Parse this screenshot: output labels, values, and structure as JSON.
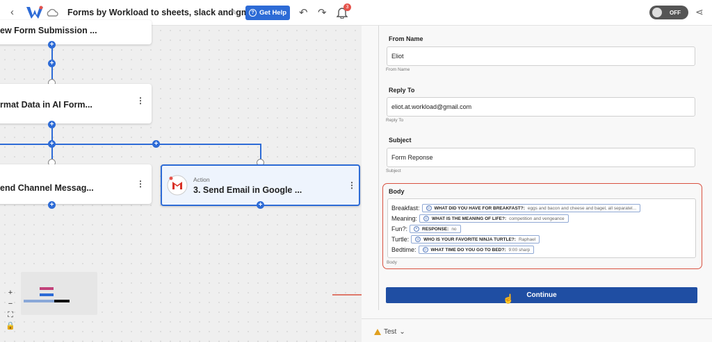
{
  "header": {
    "back_icon": "chevron-left-icon",
    "title": "Forms by Workload to sheets, slack and gmail",
    "get_help_label": "Get Help",
    "notification_count": "3",
    "toggle_label": "OFF"
  },
  "canvas": {
    "nodes": [
      {
        "title": "ew Form Submission ..."
      },
      {
        "title": "rmat Data in AI Form..."
      },
      {
        "title": "end Channel Messag..."
      },
      {
        "subtitle": "Action",
        "title": "3. Send Email in Google ..."
      }
    ],
    "zoom_controls": [
      "+",
      "−",
      "⛶",
      "🔒"
    ]
  },
  "panel": {
    "fields": [
      {
        "label": "From Name",
        "value": "Eliot",
        "hint": "From Name"
      },
      {
        "label": "Reply To",
        "value": "eliot.at.workload@gmail.com",
        "hint": "Reply To"
      },
      {
        "label": "Subject",
        "value": "Form Reponse",
        "hint": "Subject"
      }
    ],
    "body": {
      "label": "Body",
      "hint": "Body",
      "rows": [
        {
          "label": "Breakfast:",
          "key": "WHAT DID YOU HAVE FOR BREAKFAST?:",
          "value": "eggs and bacon and cheese and bagel, all separatel..."
        },
        {
          "label": "Meaning:",
          "key": "WHAT IS THE MEANING OF LIFE?:",
          "value": "competition and vengeance"
        },
        {
          "label": "Fun?:",
          "key": "RESPONSE:",
          "value": "no"
        },
        {
          "label": "Turtle:",
          "key": "WHO IS YOUR FAVORITE NINJA TURTLE?:",
          "value": "Raphael"
        },
        {
          "label": "Bedtime:",
          "key": "WHAT TIME DO YOU GO TO BED?:",
          "value": "9:00 sharp"
        }
      ]
    },
    "continue_label": "Continue",
    "test_label": "Test"
  },
  "colors": {
    "accent": "#2d6bd6",
    "continue": "#1f4ea3",
    "highlight": "#d9503f"
  }
}
